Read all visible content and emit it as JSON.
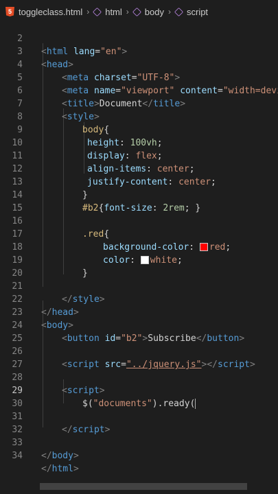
{
  "breadcrumb": {
    "file": "toggleclass.html",
    "path": [
      "html",
      "body",
      "script"
    ],
    "separator": "›"
  },
  "colors": {
    "background": "#1e1e1e",
    "tag": "#569cd6",
    "attribute": "#9cdcfe",
    "string": "#ce9178",
    "selector": "#d7ba7d",
    "number": "#b5cea8",
    "red_swatch": "#ff0000",
    "white_swatch": "#ffffff"
  },
  "editor": {
    "active_line": 29,
    "line_numbers": [
      "2",
      "3",
      "4",
      "5",
      "6",
      "7",
      "8",
      "9",
      "10",
      "11",
      "12",
      "13",
      "14",
      "15",
      "16",
      "17",
      "18",
      "19",
      "20",
      "21",
      "22",
      "23",
      "24",
      "25",
      "26",
      "27",
      "28",
      "29",
      "30",
      "31",
      "32",
      "33",
      "34"
    ],
    "code": {
      "l2_tag": "html",
      "l2_attr": "lang",
      "l2_val": "\"en\"",
      "l3_tag": "head",
      "l4_tag": "meta",
      "l4_attr": "charset",
      "l4_val": "\"UTF-8\"",
      "l5_tag": "meta",
      "l5_attr1": "name",
      "l5_val1": "\"viewport\"",
      "l5_attr2": "content",
      "l5_val2": "\"width=devic",
      "l6_tag": "title",
      "l6_text": "Document",
      "l6_close": "title",
      "l7_tag": "style",
      "l8_sel": "body",
      "l9_prop": "height",
      "l9_val": "100vh",
      "l10_prop": "display",
      "l10_val": "flex",
      "l11_prop": "align-items",
      "l11_val": "center",
      "l12_prop": "justify-content",
      "l12_val": "center",
      "l14_sel": "#b2",
      "l14_prop": "font-size",
      "l14_val": "2rem",
      "l16_sel": ".red",
      "l17_prop": "background-color",
      "l17_val": "red",
      "l18_prop": "color",
      "l18_val": "white",
      "l21_tag": "style",
      "l22_tag": "head",
      "l23_tag": "body",
      "l24_tag": "button",
      "l24_attr": "id",
      "l24_val": "\"b2\"",
      "l24_text": "Subscribe",
      "l24_close": "button",
      "l26_tag": "script",
      "l26_attr": "src",
      "l26_val": "\"../jquery.js\"",
      "l26_close": "script",
      "l28_tag": "script",
      "l29_text1": "$(",
      "l29_str": "\"documents\"",
      "l29_text2": ").ready(",
      "l31_tag": "script",
      "l33_tag": "body",
      "l34_tag": "html"
    }
  }
}
